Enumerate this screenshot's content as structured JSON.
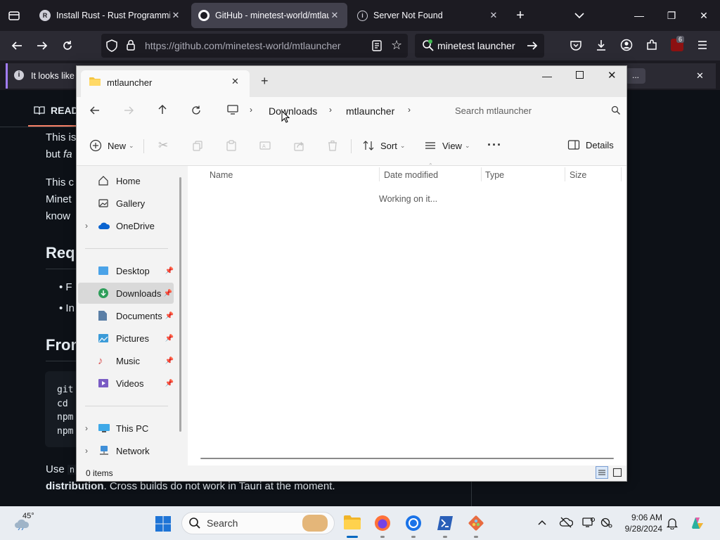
{
  "browser": {
    "tabs": [
      {
        "title": "Install Rust - Rust Programming",
        "icon": "rust-icon",
        "active": false
      },
      {
        "title": "GitHub - minetest-world/mtlau",
        "icon": "github-icon",
        "active": true
      },
      {
        "title": "Server Not Found",
        "icon": "info-icon",
        "active": false
      }
    ],
    "url": "https://github.com/minetest-world/mtlauncher",
    "search_text": "minetest launcher",
    "extension_badge": "6",
    "notification": "It looks like",
    "notification_more": "..."
  },
  "page": {
    "readme_tab": "READ",
    "line1": "This is",
    "line2a": "but ",
    "line2b": "fa",
    "line3": "This c",
    "line4": "Minet",
    "line5": "know",
    "heading1": "Req",
    "bullet1": "F",
    "bullet2": "In",
    "heading2": "From",
    "code": [
      "git",
      "cd ",
      "npm",
      "npm"
    ],
    "footer_a": "Use",
    "footer_code": "n",
    "footer_bold": "distribution",
    "footer_rest": ". Cross builds do not work in Tauri at the moment."
  },
  "explorer": {
    "tab_title": "mtlauncher",
    "breadcrumb": [
      "Downloads",
      "mtlauncher"
    ],
    "search_placeholder": "Search mtlauncher",
    "toolbar": {
      "new": "New",
      "sort": "Sort",
      "view": "View",
      "details": "Details"
    },
    "nav_items": [
      {
        "label": "Home",
        "expandable": false
      },
      {
        "label": "Gallery",
        "expandable": false
      },
      {
        "label": "OneDrive",
        "expandable": true
      }
    ],
    "quick_access": [
      {
        "label": "Desktop",
        "selected": false
      },
      {
        "label": "Downloads",
        "selected": true
      },
      {
        "label": "Documents",
        "selected": false
      },
      {
        "label": "Pictures",
        "selected": false
      },
      {
        "label": "Music",
        "selected": false
      },
      {
        "label": "Videos",
        "selected": false
      }
    ],
    "devices": [
      {
        "label": "This PC"
      },
      {
        "label": "Network"
      }
    ],
    "columns": [
      "Name",
      "Date modified",
      "Type",
      "Size"
    ],
    "status_message": "Working on it...",
    "item_count": "0 items"
  },
  "taskbar": {
    "weather_temp": "45°",
    "search_label": "Search",
    "time": "9:06 AM",
    "date": "9/28/2024"
  },
  "colors": {
    "accent": "#0067c0",
    "folder": "#f5c542",
    "browser_bg": "#1c1b22",
    "github_bg": "#0d1117"
  }
}
